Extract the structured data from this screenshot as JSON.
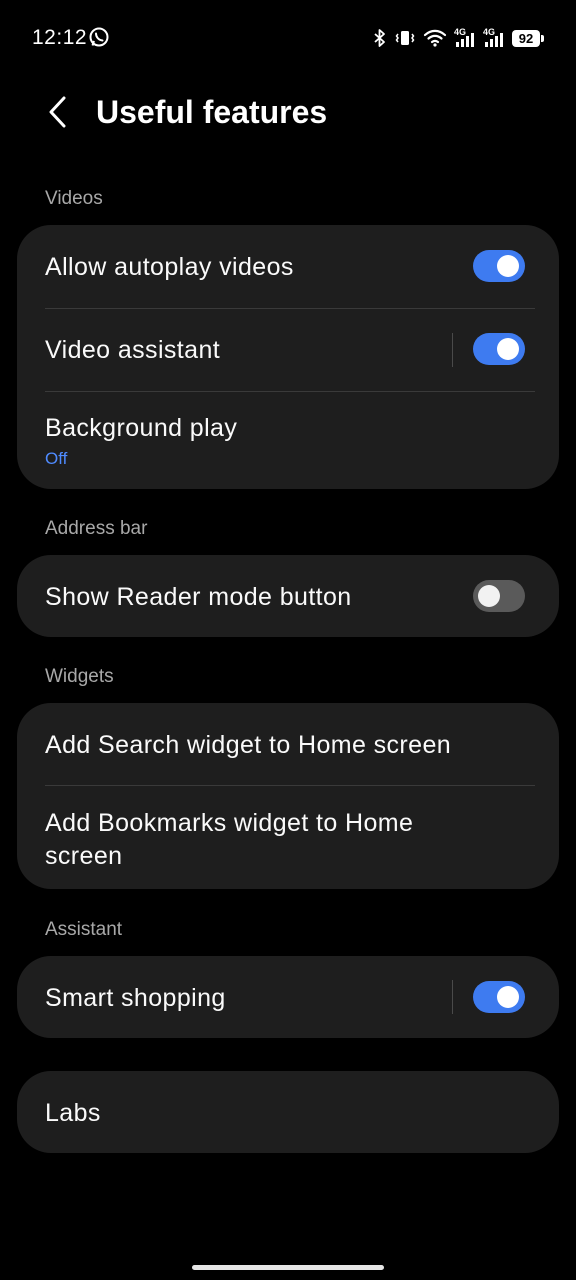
{
  "status_bar": {
    "time": "12:12",
    "battery": "92",
    "icons": [
      "whatsapp-icon",
      "bluetooth-icon",
      "vibrate-icon",
      "wifi-icon",
      "signal-4g-icon",
      "signal-4g-icon",
      "battery-icon"
    ],
    "network_label_1": "4G",
    "network_label_2": "4G"
  },
  "header": {
    "title": "Useful features",
    "back_icon": "chevron-left-icon"
  },
  "sections": {
    "videos": {
      "label": "Videos",
      "allow_autoplay": {
        "label": "Allow autoplay videos",
        "enabled": true
      },
      "video_assistant": {
        "label": "Video assistant",
        "enabled": true
      },
      "background_play": {
        "label": "Background play",
        "value": "Off"
      }
    },
    "address_bar": {
      "label": "Address bar",
      "reader_mode": {
        "label": "Show Reader mode button",
        "enabled": false
      }
    },
    "widgets": {
      "label": "Widgets",
      "search_widget": {
        "label": "Add Search widget to Home screen"
      },
      "bookmarks_widget": {
        "label_line1": "Add Bookmarks widget to Home",
        "label_line2": "screen"
      }
    },
    "assistant": {
      "label": "Assistant",
      "smart_shopping": {
        "label": "Smart shopping",
        "enabled": true
      }
    },
    "labs": {
      "label": "Labs"
    }
  },
  "colors": {
    "background": "#000000",
    "card": "#1e1e1e",
    "accent": "#3e7bf0",
    "sub_value": "#4f8bff",
    "section_label": "#a8a8a8"
  }
}
